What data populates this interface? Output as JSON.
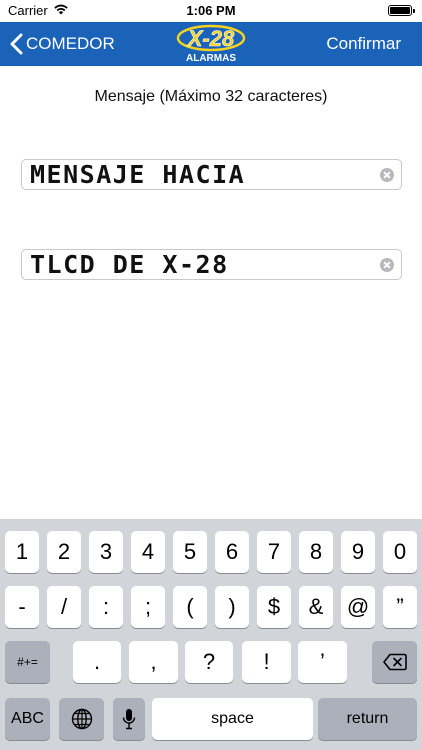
{
  "status_bar": {
    "carrier": "Carrier",
    "time": "1:06 PM",
    "battery_level": 1.0
  },
  "nav_bar": {
    "back_label": "COMEDOR",
    "logo_line1": "X-28",
    "logo_line2": "ALARMAS",
    "confirm_label": "Confirmar",
    "color": "#1a63b8"
  },
  "content": {
    "hint": "Mensaje (Máximo 32 caracteres)",
    "line1_value": "MENSAJE HACIA",
    "line2_value": "TLCD DE X-28"
  },
  "keyboard": {
    "row1": [
      "1",
      "2",
      "3",
      "4",
      "5",
      "6",
      "7",
      "8",
      "9",
      "0"
    ],
    "row2": [
      "-",
      "/",
      ":",
      ";",
      "(",
      ")",
      "$",
      "&",
      "@",
      "”"
    ],
    "row3": {
      "shift_label": "#+=",
      "keys": [
        ".",
        ",",
        "?",
        "!",
        "’"
      ]
    },
    "row4": {
      "abc_label": "ABC",
      "space_label": "space",
      "return_label": "return"
    }
  }
}
